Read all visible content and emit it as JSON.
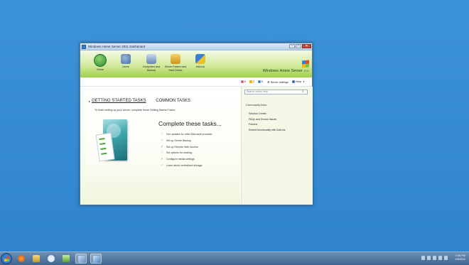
{
  "window": {
    "title": "Windows Home Server 2011 Dashboard",
    "controls": {
      "minimize": "–",
      "maximize": "□",
      "close": "✕"
    }
  },
  "nav": [
    {
      "label": "Home",
      "icon": "home-icon"
    },
    {
      "label": "Users",
      "icon": "users-icon"
    },
    {
      "label": "Computers and Backup",
      "icon": "computers-icon"
    },
    {
      "label": "Server Folders and Hard Drives",
      "icon": "folders-icon"
    },
    {
      "label": "Add-Ins",
      "icon": "addins-icon"
    }
  ],
  "brand": {
    "name": "Windows Home Server",
    "version": "2011"
  },
  "status": {
    "critical": "0",
    "warning": "2",
    "info": "0",
    "settings_label": "Server settings",
    "help_label": "Help",
    "colors": {
      "critical": "#e05a8a",
      "warning": "#f0b400",
      "info": "#4a7fd4"
    }
  },
  "tabs": {
    "getting_started": "GETTING STARTED TASKS",
    "common": "COMMON TASKS"
  },
  "intro": "To finish setting up your server, complete these Getting Started Tasks.",
  "headline": "Complete these tasks...",
  "tasks": [
    {
      "label": "Get updates for other Microsoft products",
      "done": false
    },
    {
      "label": "Set up Server Backup",
      "done": false
    },
    {
      "label": "Set up Remote Web Access",
      "done": true
    },
    {
      "label": "Set options for sharing",
      "done": false
    },
    {
      "label": "Configure media settings",
      "done": true
    },
    {
      "label": "Learn about centralized storage",
      "done": false
    }
  ],
  "search": {
    "placeholder": "Search online help"
  },
  "community": {
    "title": "Community links",
    "links": [
      "Solution Center",
      "FAQs and Known Issues",
      "Forums",
      "Extend functionality with Add-ins"
    ]
  },
  "clock": {
    "time": "3:05 PM",
    "date": "2/8/2011"
  }
}
